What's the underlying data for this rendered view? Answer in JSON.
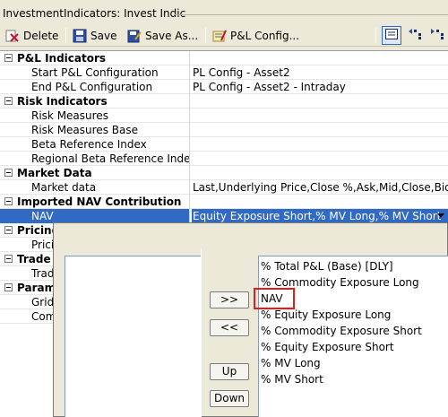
{
  "window": {
    "title": "InvestmentIndicators: Invest Indic"
  },
  "toolbar": {
    "delete_label": "Delete",
    "save_label": "Save",
    "save_as_label": "Save As...",
    "pl_config_label": "P&L Config..."
  },
  "grid": {
    "rows": [
      {
        "label": "P&L Indicators",
        "value": "",
        "kind": "group"
      },
      {
        "label": "Start P&L Configuration",
        "value": "PL Config - Asset2",
        "kind": "child"
      },
      {
        "label": "End P&L Configuration",
        "value": "PL Config - Asset2 - Intraday",
        "kind": "child"
      },
      {
        "label": "Risk Indicators",
        "value": "",
        "kind": "group"
      },
      {
        "label": "Risk Measures",
        "value": "",
        "kind": "child"
      },
      {
        "label": "Risk Measures Base",
        "value": "",
        "kind": "child"
      },
      {
        "label": "Beta Reference Index",
        "value": "",
        "kind": "child"
      },
      {
        "label": "Regional Beta Reference Index",
        "value": "",
        "kind": "child"
      },
      {
        "label": "Market Data",
        "value": "",
        "kind": "group"
      },
      {
        "label": "Market data",
        "value": "Last,Underlying Price,Close %,Ask,Mid,Close,Bid",
        "kind": "child"
      },
      {
        "label": "Imported NAV Contribution",
        "value": "",
        "kind": "group"
      },
      {
        "label": "NAV",
        "value": "Equity Exposure Short,% MV Long,% MV Short",
        "kind": "selected"
      },
      {
        "label": "Pricing",
        "value": "",
        "kind": "group"
      },
      {
        "label": "Prici",
        "value": "",
        "kind": "child"
      },
      {
        "label": "Trade",
        "value": "",
        "kind": "group"
      },
      {
        "label": "Trad",
        "value": "",
        "kind": "child"
      },
      {
        "label": "Param",
        "value": "",
        "kind": "group"
      },
      {
        "label": "Grid",
        "value": "",
        "kind": "child"
      },
      {
        "label": "Comr",
        "value": "",
        "kind": "child"
      }
    ]
  },
  "popup": {
    "add_label": ">>",
    "remove_label": "<<",
    "up_label": "Up",
    "down_label": "Down",
    "right_list": [
      "% Total P&L (Base) [DLY]",
      "% Commodity Exposure Long",
      "NAV",
      "% Equity Exposure Long",
      "% Commodity Exposure Short",
      "% Equity Exposure Short",
      "% MV Long",
      "% MV Short"
    ],
    "highlighted_item_index": 2
  },
  "colors": {
    "selection": "#316ac5",
    "highlight_box": "#e31b1b"
  },
  "icons": [
    "delete-icon",
    "save-icon",
    "save-as-icon",
    "pl-config-icon",
    "list-view-icon",
    "expand-icon",
    "collapse-icon"
  ]
}
